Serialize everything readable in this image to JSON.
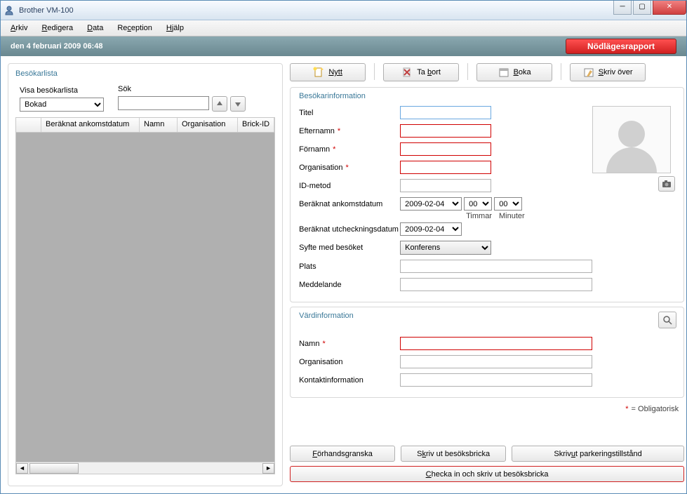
{
  "window": {
    "title": "Brother VM-100"
  },
  "menu": {
    "arkiv": "Arkiv",
    "redigera": "Redigera",
    "data": "Data",
    "reception": "Reception",
    "hjalp": "Hjälp"
  },
  "datebar": {
    "date": "den 4 februari 2009 06:48",
    "emergency": "Nödlägesrapport"
  },
  "left": {
    "title": "Besökarlista",
    "show_label": "Visa besökarlista",
    "search_label": "Sök",
    "filter_value": "Bokad",
    "columns": {
      "c1": "Beräknat ankomstdatum",
      "c2": "Namn",
      "c3": "Organisation",
      "c4": "Brick-ID"
    }
  },
  "toolbar": {
    "nytt": "Nytt",
    "tabort": "Ta bort",
    "boka": "Boka",
    "skrivover": "Skriv över"
  },
  "visitor": {
    "group": "Besökarinformation",
    "titel": "Titel",
    "efternamn": "Efternamn",
    "fornamn": "Förnamn",
    "organisation": "Organisation",
    "idmetod": "ID-metod",
    "arrival": "Beräknat ankomstdatum",
    "checkout": "Beräknat utcheckningsdatum",
    "purpose": "Syfte med besöket",
    "plats": "Plats",
    "meddelande": "Meddelande",
    "date_value": "2009-02-04",
    "time_h": "00",
    "time_m": "00",
    "timmar": "Timmar",
    "minuter": "Minuter",
    "purpose_value": "Konferens"
  },
  "host": {
    "group": "Värdinformation",
    "namn": "Namn",
    "organisation": "Organisation",
    "kontakt": "Kontaktinformation"
  },
  "mandatory": "= Obligatorisk",
  "bottom": {
    "preview": "Förhandsgranska",
    "print_badge": "Skriv ut besöksbricka",
    "print_parking": "Skriv ut parkeringstillstånd",
    "checkin": "Checka in och skriv ut besöksbricka"
  }
}
